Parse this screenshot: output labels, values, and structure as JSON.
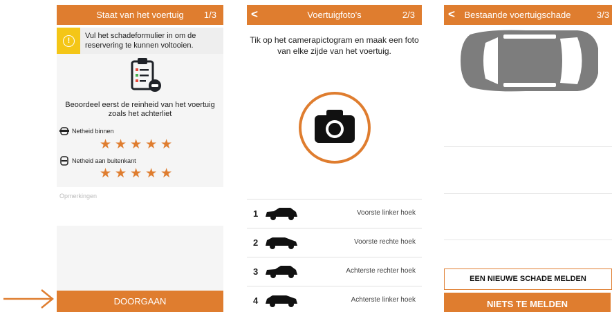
{
  "screen1": {
    "title": "Staat van het voertuig",
    "step": "1/3",
    "notice": "Vul het schadeformulier in om de reservering te kunnen voltooien.",
    "question": "Beoordeel eerst de reinheid van het voertuig zoals het achterliet",
    "ratings": [
      {
        "label": "Netheid binnen",
        "stars": "★★★★★",
        "value": 5
      },
      {
        "label": "Netheid aan buitenkant",
        "stars": "★★★★★",
        "value": 5
      }
    ],
    "remarks_placeholder": "Opmerkingen",
    "continue_label": "DOORGAAN"
  },
  "screen2": {
    "title": "Voertuigfoto's",
    "step": "2/3",
    "back": "<",
    "instruction": "Tik op het camerapictogram en maak een foto van elke zijde van het voertuig.",
    "photos": [
      {
        "num": "1",
        "label": "Voorste linker hoek"
      },
      {
        "num": "2",
        "label": "Voorste rechte hoek"
      },
      {
        "num": "3",
        "label": "Achterste rechter hoek"
      },
      {
        "num": "4",
        "label": "Achterste linker hoek"
      }
    ]
  },
  "screen3": {
    "title": "Bestaande voertuigschade",
    "step": "3/3",
    "back": "<",
    "new_damage_label": "EEN NIEUWE SCHADE MELDEN",
    "nothing_label": "NIETS TE MELDEN"
  },
  "colors": {
    "accent": "#df7d2f",
    "warning": "#f4c617",
    "panel": "#f5f5f5"
  },
  "icons": [
    "clipboard-car-icon",
    "camera-icon",
    "car-top-view-icon",
    "warning-icon",
    "arrow-right-icon"
  ]
}
